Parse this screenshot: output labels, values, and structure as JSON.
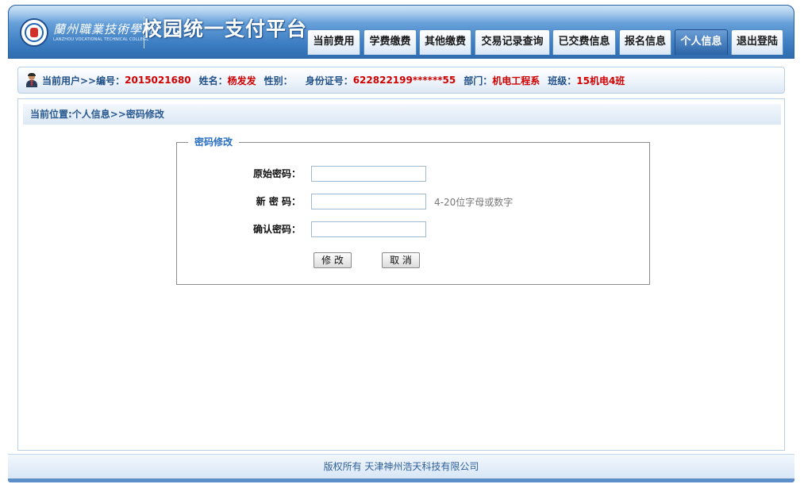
{
  "header": {
    "logo_cn": "蘭州職業技術學院",
    "logo_en": "LANZHOU VOCATIONAL TECHNICAL COLLEGE",
    "title": "校园统一支付平台"
  },
  "nav": {
    "items": [
      "当前费用",
      "学费缴费",
      "其他缴费",
      "交易记录查询",
      "已交费信息",
      "报名信息",
      "个人信息",
      "退出登陆"
    ],
    "active": "个人信息"
  },
  "user": {
    "current_user_label": "当前用户>>",
    "id_label": "编号：",
    "id_value": "2015021680",
    "name_label": "姓名：",
    "name_value": "杨发发",
    "gender_label": "性别：",
    "gender_value": "",
    "idcard_label": "身份证号：",
    "idcard_value": "622822199******55",
    "dept_label": "部门：",
    "dept_value": "机电工程系",
    "class_label": "班级：",
    "class_value": "15机电4班"
  },
  "breadcrumb": "当前位置:个人信息>>密码修改",
  "form": {
    "legend": "密码修改",
    "old_password_label": "原始密码：",
    "old_password_value": "",
    "new_password_label": "新 密 码：",
    "new_password_value": "",
    "new_password_hint": "4-20位字母或数字",
    "confirm_password_label": "确认密码：",
    "confirm_password_value": "",
    "submit_label": "修 改",
    "cancel_label": "取 消"
  },
  "footer": "版权所有 天津神州浩天科技有限公司",
  "colors": {
    "header_blue": "#3f7fc3",
    "active_tab": "#2c64a8",
    "value_red": "#d00000",
    "label_blue": "#1f4f86",
    "legend_blue": "#2a6fc0"
  },
  "icons": [
    "college-logo-icon",
    "user-avatar-icon"
  ]
}
